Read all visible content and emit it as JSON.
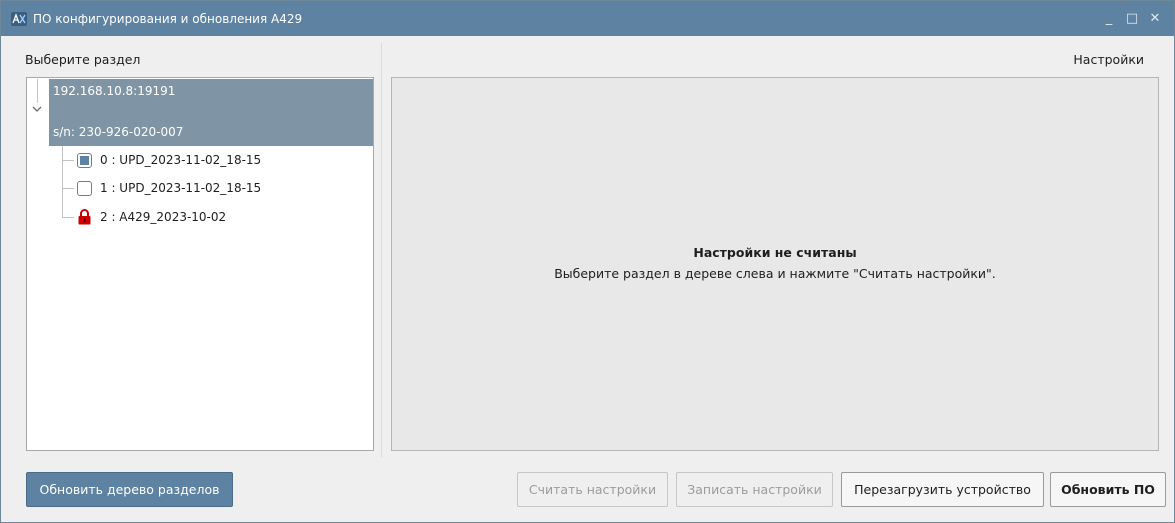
{
  "window": {
    "title": "ПО конфигурирования и обновления А429",
    "minimize_glyph": "_",
    "maximize_glyph": "□",
    "close_glyph": "✕"
  },
  "left_panel": {
    "label": "Выберите раздел",
    "device": {
      "ip": "192.168.10.8:19191",
      "serial": "s/n: 230-926-020-007",
      "expanded": true
    },
    "partitions": [
      {
        "label": "0 : UPD_2023-11-02_18-15",
        "state": "checked",
        "icon": "checkbox-icon"
      },
      {
        "label": "1 : UPD_2023-11-02_18-15",
        "state": "unchecked",
        "icon": "checkbox-icon"
      },
      {
        "label": "2 : A429_2023-10-02",
        "state": "locked",
        "icon": "lock-icon"
      }
    ]
  },
  "right_panel": {
    "label": "Настройки",
    "empty_title": "Настройки не считаны",
    "empty_hint": "Выберите раздел в дереве слева и нажмите \"Считать настройки\"."
  },
  "buttons": {
    "refresh_tree": "Обновить дерево разделов",
    "read_settings": "Считать настройки",
    "write_settings": "Записать настройки",
    "reboot_device": "Перезагрузить устройство",
    "update_firmware": "Обновить ПО"
  },
  "colors": {
    "accent": "#5e82a1",
    "selection": "#7f95a5",
    "lock": "#cc0000"
  }
}
